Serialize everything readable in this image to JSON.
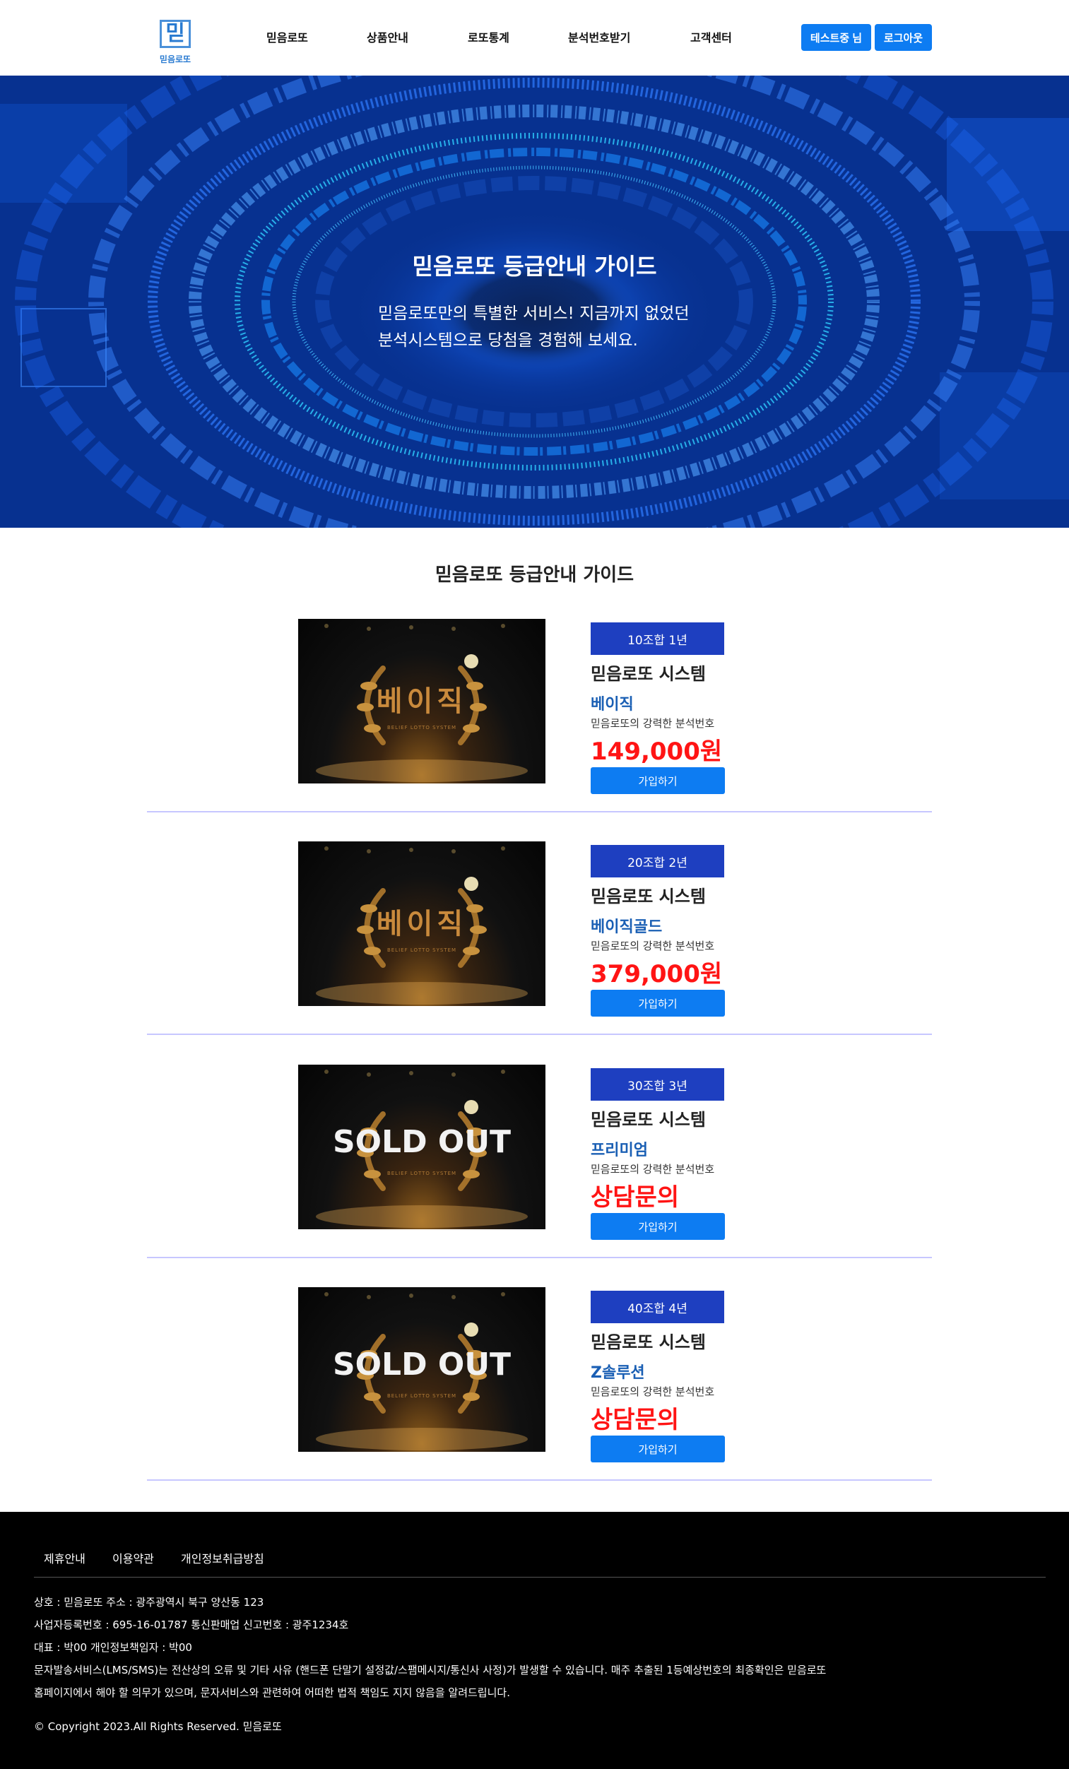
{
  "header": {
    "logo_glyph": "믿",
    "logo_text": "믿음로또",
    "nav": [
      "믿음로또",
      "상품안내",
      "로또통계",
      "분석번호받기",
      "고객센터"
    ],
    "user_button": "테스트중 님",
    "logout_button": "로그아웃"
  },
  "hero": {
    "title": "믿음로또 등급안내 가이드",
    "subtitle_line1": "믿음로또만의 특별한 서비스! 지금까지 없었던",
    "subtitle_line2": "분석시스템으로 당첨을 경험해 보세요."
  },
  "main": {
    "title": "믿음로또 등급안내 가이드",
    "products": [
      {
        "image_text": "베이직",
        "image_sub": "BELIEF LOTTO SYSTEM",
        "tag": "10조합 1년",
        "system": "믿음로또 시스템",
        "grade": "베이직",
        "desc": "믿음로또의 강력한 분석번호",
        "price": "149,000원",
        "button": "가입하기"
      },
      {
        "image_text": "베이직",
        "image_sub": "BELIEF LOTTO SYSTEM",
        "tag": "20조합 2년",
        "system": "믿음로또 시스템",
        "grade": "베이직골드",
        "desc": "믿음로또의 강력한 분석번호",
        "price": "379,000원",
        "button": "가입하기"
      },
      {
        "image_text": "SOLD OUT",
        "image_sub": "BELIEF LOTTO SYSTEM",
        "tag": "30조합 3년",
        "system": "믿음로또 시스템",
        "grade": "프리미엄",
        "desc": "믿음로또의 강력한 분석번호",
        "price": "상담문의",
        "button": "가입하기"
      },
      {
        "image_text": "SOLD OUT",
        "image_sub": "BELIEF LOTTO SYSTEM",
        "tag": "40조합 4년",
        "system": "믿음로또 시스템",
        "grade": "Z솔루션",
        "desc": "믿음로또의 강력한 분석번호",
        "price": "상담문의",
        "button": "가입하기"
      }
    ]
  },
  "footer": {
    "links": [
      "제휴안내",
      "이용약관",
      "개인정보취급방침"
    ],
    "info": [
      "상호 : 믿음로또 주소 : 광주광역시 북구 양산동 123",
      "사업자등록번호 : 695-16-01787 통신판매업 신고번호 : 광주1234호",
      "대표 : 박00 개인정보책임자 : 박00",
      "문자발송서비스(LMS/SMS)는 전산상의 오류 및 기타 사유 (핸드폰 단말기 설정값/스팸메시지/통신사 사정)가 발생할 수 있습니다. 매주 추출된 1등예상번호의 최종확인은 믿음로또",
      "홈페이지에서 해야 할 의무가 있으며, 문자서비스와 관련하여 어떠한 법적 책임도 지지 않음을 알려드립니다."
    ],
    "copyright": "© Copyright 2023.All Rights Reserved. 믿음로또"
  }
}
